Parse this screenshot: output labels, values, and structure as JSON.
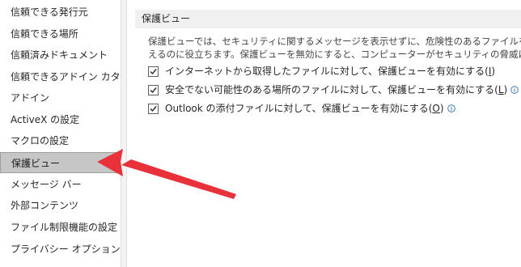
{
  "sidebar": {
    "items": [
      {
        "label": "信頼できる発行元"
      },
      {
        "label": "信頼できる場所"
      },
      {
        "label": "信頼済みドキュメント"
      },
      {
        "label": "信頼できるアドイン カタログ"
      },
      {
        "label": "アドイン"
      },
      {
        "label": "ActiveX の設定"
      },
      {
        "label": "マクロの設定"
      },
      {
        "label": "保護ビュー"
      },
      {
        "label": "メッセージ バー"
      },
      {
        "label": "外部コンテンツ"
      },
      {
        "label": "ファイル制限機能の設定"
      },
      {
        "label": "プライバシー オプション"
      }
    ],
    "selected_index": 7
  },
  "main": {
    "section_title": "保護ビュー",
    "description_line1": "保護ビューでは、セキュリティに関するメッセージを表示せずに、危険性のあるファイルを制限モードで開",
    "description_line2": "えるのに役立ちます。保護ビューを無効にすると、コンピューターがセキュリティの脅威にさらされる可能性",
    "options": [
      {
        "label_prefix": "インターネットから取得したファイルに対して、保護ビューを有効にする(",
        "accel": "I",
        "label_suffix": ")",
        "checked": true,
        "info": false
      },
      {
        "label_prefix": "安全でない可能性のある場所のファイルに対して、保護ビューを有効にする(",
        "accel": "L",
        "label_suffix": ")",
        "checked": true,
        "info": true
      },
      {
        "label_prefix": "Outlook の添付ファイルに対して、保護ビューを有効にする(",
        "accel": "O",
        "label_suffix": ")",
        "checked": true,
        "info": true
      }
    ]
  },
  "colors": {
    "arrow": "#e8313a",
    "selected_bg": "#c6c6c6",
    "header_bg": "#f0f0f0",
    "info_icon": "#2b6cb0"
  }
}
